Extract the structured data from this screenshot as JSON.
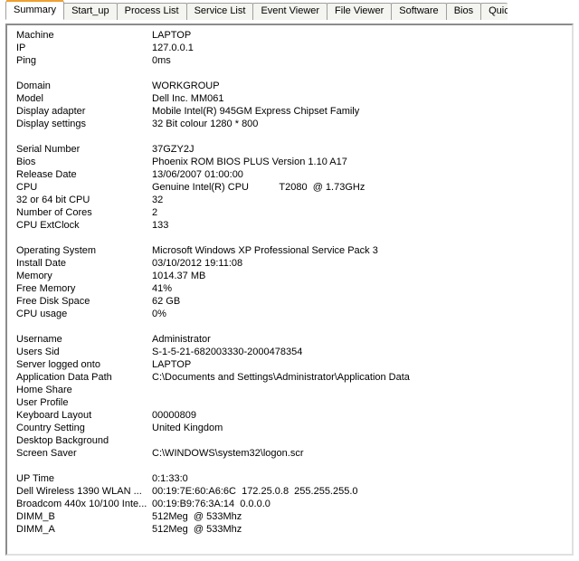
{
  "tabs": [
    {
      "label": "Summary",
      "active": true
    },
    {
      "label": "Start_up",
      "active": false
    },
    {
      "label": "Process List",
      "active": false
    },
    {
      "label": "Service List",
      "active": false
    },
    {
      "label": "Event Viewer",
      "active": false
    },
    {
      "label": "File Viewer",
      "active": false
    },
    {
      "label": "Software",
      "active": false
    },
    {
      "label": "Bios",
      "active": false
    },
    {
      "label": "Quick",
      "active": false,
      "cut": true
    }
  ],
  "groups": [
    [
      {
        "label": "Machine",
        "value": "LAPTOP"
      },
      {
        "label": "IP",
        "value": "127.0.0.1"
      },
      {
        "label": "Ping",
        "value": "0ms"
      }
    ],
    [
      {
        "label": "Domain",
        "value": "WORKGROUP"
      },
      {
        "label": "Model",
        "value": "Dell Inc. MM061"
      },
      {
        "label": "Display adapter",
        "value": "Mobile Intel(R) 945GM Express Chipset Family"
      },
      {
        "label": "Display settings",
        "value": "32 Bit colour 1280 * 800"
      }
    ],
    [
      {
        "label": "Serial Number",
        "value": "37GZY2J"
      },
      {
        "label": "Bios",
        "value": "Phoenix ROM BIOS PLUS Version 1.10 A17"
      },
      {
        "label": "Release Date",
        "value": "13/06/2007 01:00:00"
      },
      {
        "label": "CPU",
        "value": "Genuine Intel(R) CPU           T2080  @ 1.73GHz"
      },
      {
        "label": "32 or 64 bit CPU",
        "value": "32"
      },
      {
        "label": "Number of Cores",
        "value": "2"
      },
      {
        "label": "CPU ExtClock",
        "value": "133"
      }
    ],
    [
      {
        "label": "Operating System",
        "value": "Microsoft Windows XP Professional Service Pack 3"
      },
      {
        "label": "Install Date",
        "value": "03/10/2012 19:11:08"
      },
      {
        "label": "Memory",
        "value": "1014.37 MB"
      },
      {
        "label": "Free Memory",
        "value": "41%"
      },
      {
        "label": "Free Disk Space",
        "value": "62 GB"
      },
      {
        "label": "CPU usage",
        "value": "0%"
      }
    ],
    [
      {
        "label": "Username",
        "value": "Administrator"
      },
      {
        "label": "Users Sid",
        "value": "S-1-5-21-682003330-2000478354"
      },
      {
        "label": "Server logged onto",
        "value": "LAPTOP"
      },
      {
        "label": "Application Data Path",
        "value": "C:\\Documents and Settings\\Administrator\\Application Data"
      },
      {
        "label": "Home Share",
        "value": ""
      },
      {
        "label": "User Profile",
        "value": ""
      },
      {
        "label": "Keyboard Layout",
        "value": "00000809"
      },
      {
        "label": "Country Setting",
        "value": "United Kingdom"
      },
      {
        "label": "Desktop Background",
        "value": ""
      },
      {
        "label": "Screen Saver",
        "value": "C:\\WINDOWS\\system32\\logon.scr"
      }
    ],
    [
      {
        "label": "UP Time",
        "value": "0:1:33:0"
      },
      {
        "label": "Dell Wireless 1390 WLAN ...",
        "value": "00:19:7E:60:A6:6C  172.25.0.8  255.255.255.0"
      },
      {
        "label": "Broadcom 440x 10/100 Inte...",
        "value": "00:19:B9:76:3A:14  0.0.0.0"
      },
      {
        "label": "DIMM_B",
        "value": "512Meg  @ 533Mhz"
      },
      {
        "label": "DIMM_A",
        "value": "512Meg  @ 533Mhz"
      }
    ]
  ]
}
